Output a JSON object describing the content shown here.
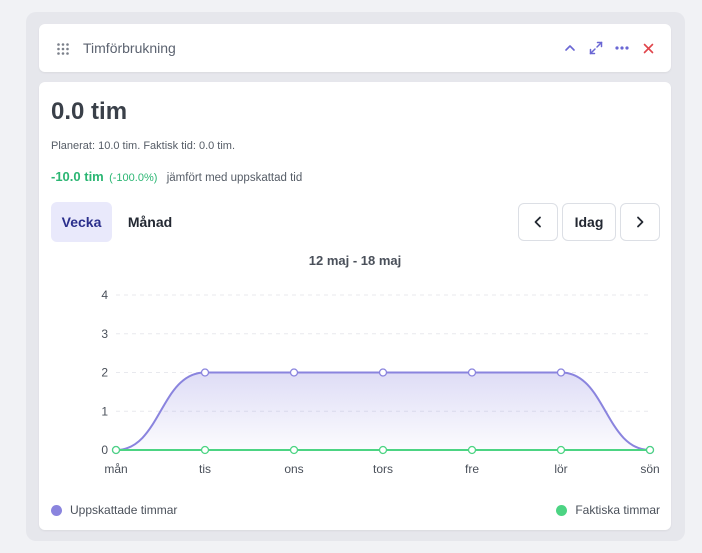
{
  "widget": {
    "title": "Timförbrukning",
    "icons": [
      "drag-handle-icon",
      "chevron-up-icon",
      "expand-icon",
      "more-icon",
      "close-icon"
    ]
  },
  "summary": {
    "total": "0.0 tim",
    "planned_text": "Planerat: 10.0 tim. Faktisk tid: 0.0 tim.",
    "diff_value": "-10.0 tim",
    "diff_pct": "(-100.0%)",
    "diff_text": "jämfört med uppskattad tid"
  },
  "tabs": [
    {
      "label": "Vecka",
      "active": true
    },
    {
      "label": "Månad",
      "active": false
    }
  ],
  "nav": {
    "prev": "‹",
    "today": "Idag",
    "next": "›"
  },
  "range_label": "12 maj - 18 maj",
  "colors": {
    "estimated": "#8a84de",
    "actual": "#4cd483",
    "diff": "#2bb673",
    "close": "#e0454b",
    "accent": "#6a67d4"
  },
  "chart_data": {
    "type": "area",
    "categories": [
      "mån",
      "tis",
      "ons",
      "tors",
      "fre",
      "lör",
      "sön"
    ],
    "series": [
      {
        "name": "Uppskattade timmar",
        "values": [
          0,
          2,
          2,
          2,
          2,
          2,
          0
        ],
        "color": "#8a84de"
      },
      {
        "name": "Faktiska timmar",
        "values": [
          0,
          0,
          0,
          0,
          0,
          0,
          0
        ],
        "color": "#4cd483"
      }
    ],
    "y_ticks": [
      0,
      1,
      2,
      3,
      4
    ],
    "ylim": [
      0,
      4
    ],
    "grid": true,
    "legend_position": "bottom"
  }
}
